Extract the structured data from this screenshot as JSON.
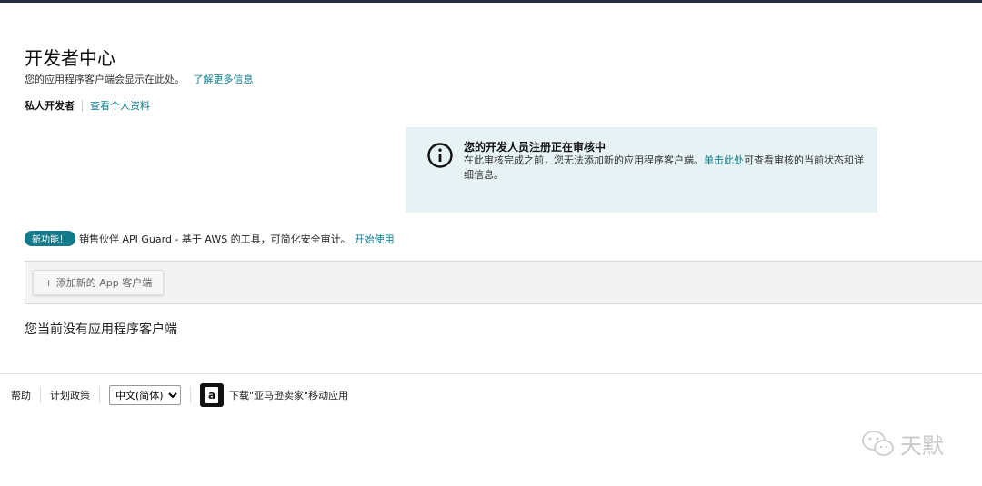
{
  "header": {
    "title": "开发者中心",
    "subtitle": "您的应用程序客户端会显示在此处。",
    "learn_more": "了解更多信息",
    "developer_type": "私人开发者",
    "view_profile": "查看个人资料"
  },
  "alert": {
    "icon": "info-circle-icon",
    "title": "您的开发人员注册正在审核中",
    "body_prefix": "在此审核完成之前，您无法添加新的应用程序客户端。",
    "body_link": "单击此处",
    "body_suffix": "可查看审核的当前状态和详细信息。"
  },
  "promo": {
    "badge": "新功能！",
    "text": "销售伙伴 API Guard - 基于 AWS 的工具，可简化安全审计。",
    "link": "开始使用"
  },
  "clients": {
    "add_button": "+ 添加新的 App 客户端",
    "empty_text": "您当前没有应用程序客户端"
  },
  "footer": {
    "help": "帮助",
    "policy": "计划政策",
    "language_selected": "中文(简体)",
    "app_icon": "amazon-a-icon",
    "download_app": "下载\"亚马逊卖家\"移动应用"
  },
  "watermark": {
    "text": "天默",
    "icon": "wechat-icon"
  },
  "colors": {
    "accent_link": "#0f7a8c",
    "badge_bg": "#137a8a",
    "alert_bg": "#e6f2f3",
    "top_bar": "#232f3e"
  }
}
